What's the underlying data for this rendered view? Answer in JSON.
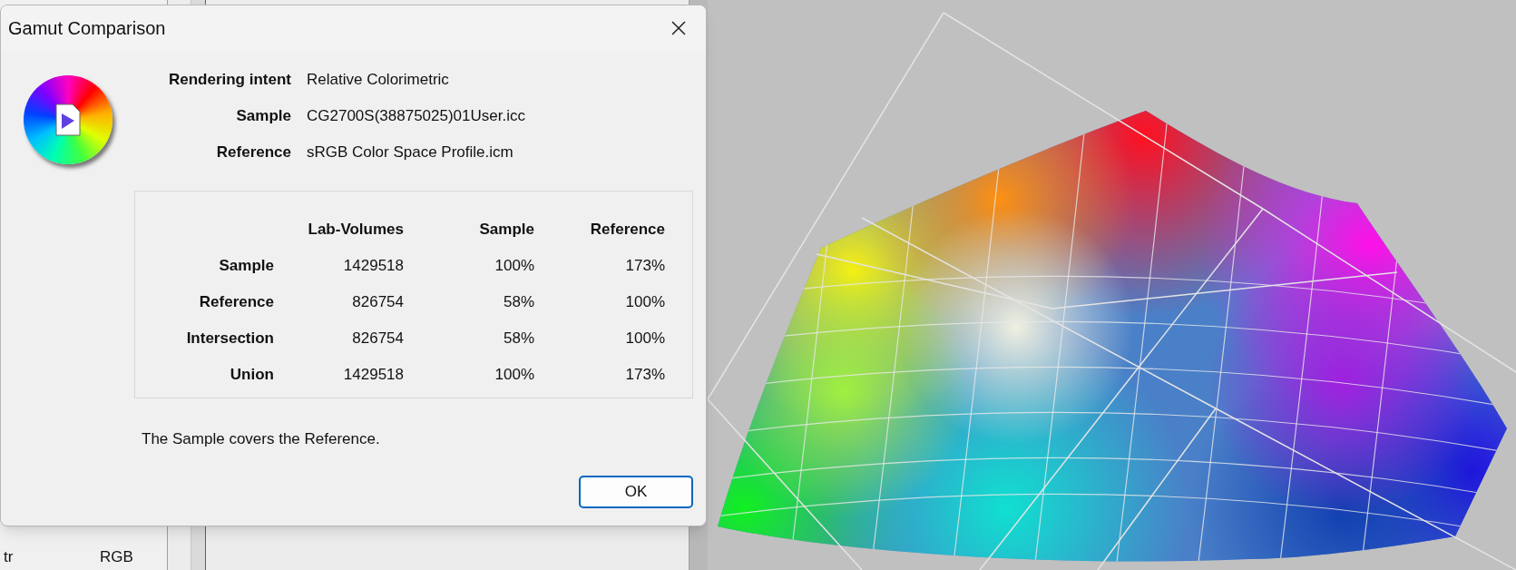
{
  "window": {
    "title": "Gamut Comparison"
  },
  "info": [
    {
      "label": "Rendering intent",
      "value": "Relative Colorimetric"
    },
    {
      "label": "Sample",
      "value": "CG2700S(38875025)01User.icc"
    },
    {
      "label": "Reference",
      "value": "sRGB Color Space Profile.icm"
    }
  ],
  "table": {
    "columns": [
      "Lab-Volumes",
      "Sample",
      "Reference"
    ],
    "rows": [
      {
        "label": "Sample",
        "cells": [
          "1429518",
          "100%",
          "173%"
        ]
      },
      {
        "label": "Reference",
        "cells": [
          "826754",
          "58%",
          "100%"
        ]
      },
      {
        "label": "Intersection",
        "cells": [
          "826754",
          "58%",
          "100%"
        ]
      },
      {
        "label": "Union",
        "cells": [
          "1429518",
          "100%",
          "173%"
        ]
      }
    ]
  },
  "message": "The Sample covers the Reference.",
  "buttons": [
    "OK"
  ],
  "background_list": {
    "rows": [
      [
        "tr",
        "RGB"
      ]
    ]
  }
}
